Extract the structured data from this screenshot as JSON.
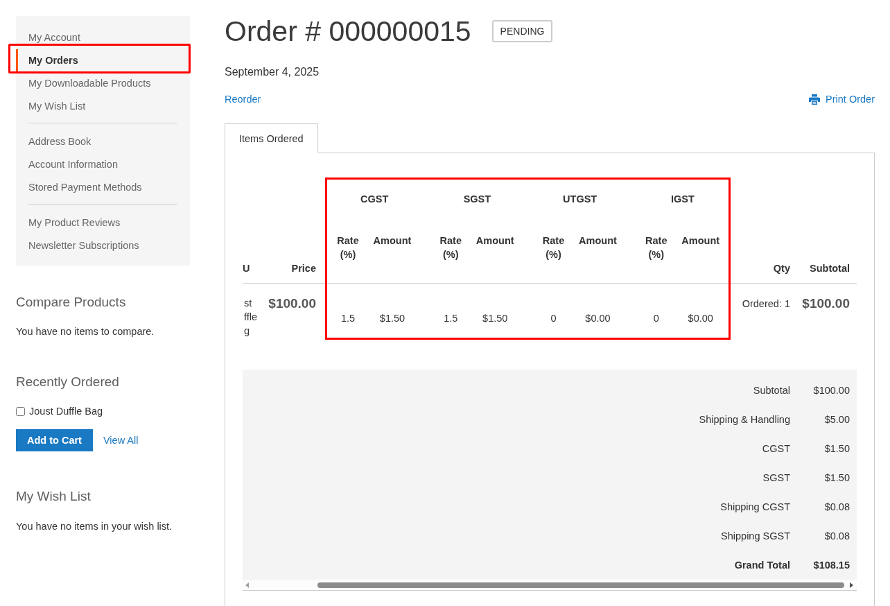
{
  "sidebar": {
    "sections": [
      {
        "items": [
          {
            "label": "My Account",
            "selected": false,
            "highlighted": false
          },
          {
            "label": "My Orders",
            "selected": true,
            "highlighted": true
          },
          {
            "label": "My Downloadable Products",
            "selected": false,
            "highlighted": false
          },
          {
            "label": "My Wish List",
            "selected": false,
            "highlighted": false
          }
        ]
      },
      {
        "items": [
          {
            "label": "Address Book",
            "selected": false,
            "highlighted": false
          },
          {
            "label": "Account Information",
            "selected": false,
            "highlighted": false
          },
          {
            "label": "Stored Payment Methods",
            "selected": false,
            "highlighted": false
          }
        ]
      },
      {
        "items": [
          {
            "label": "My Product Reviews",
            "selected": false,
            "highlighted": false
          },
          {
            "label": "Newsletter Subscriptions",
            "selected": false,
            "highlighted": false
          }
        ]
      }
    ]
  },
  "compare_products": {
    "title": "Compare Products",
    "message": "You have no items to compare."
  },
  "recently_ordered": {
    "title": "Recently Ordered",
    "items": [
      {
        "label": "Joust Duffle Bag",
        "checked": false
      }
    ],
    "add_button": "Add to Cart",
    "view_all_link": "View All"
  },
  "wish_list": {
    "title": "My Wish List",
    "message": "You have no items in your wish list."
  },
  "order": {
    "title": "Order # 000000015",
    "status": "PENDING",
    "date": "September 4, 2025",
    "reorder_link": "Reorder",
    "print_link": "Print Order"
  },
  "tabs": [
    {
      "label": "Items Ordered",
      "selected": true
    }
  ],
  "items_table": {
    "tax_columns_highlighted": true,
    "column_1": "U",
    "price_header": "Price",
    "tax_groups": [
      {
        "name": "CGST",
        "rate_header": "Rate (%)",
        "amount_header": "Amount"
      },
      {
        "name": "SGST",
        "rate_header": "Rate (%)",
        "amount_header": "Amount"
      },
      {
        "name": "UTGST",
        "rate_header": "Rate (%)",
        "amount_header": "Amount"
      },
      {
        "name": "IGST",
        "rate_header": "Rate (%)",
        "amount_header": "Amount"
      }
    ],
    "qty_header": "Qty",
    "subtotal_header": "Subtotal",
    "rows": [
      {
        "column_1": "st ffle g",
        "price": "$100.00",
        "taxes": [
          {
            "rate": "1.5",
            "amount": "$1.50"
          },
          {
            "rate": "1.5",
            "amount": "$1.50"
          },
          {
            "rate": "0",
            "amount": "$0.00"
          },
          {
            "rate": "0",
            "amount": "$0.00"
          }
        ],
        "qty": "Ordered: 1",
        "subtotal": "$100.00"
      }
    ]
  },
  "totals": [
    {
      "label": "Subtotal",
      "value": "$100.00",
      "kind": "line"
    },
    {
      "label": "Shipping & Handling",
      "value": "$5.00",
      "kind": "line"
    },
    {
      "label": "CGST",
      "value": "$1.50",
      "kind": "line"
    },
    {
      "label": "SGST",
      "value": "$1.50",
      "kind": "line"
    },
    {
      "label": "Shipping CGST",
      "value": "$0.08",
      "kind": "line"
    },
    {
      "label": "Shipping SGST",
      "value": "$0.08",
      "kind": "line"
    },
    {
      "label": "Grand Total",
      "value": "$108.15",
      "kind": "grand"
    }
  ]
}
